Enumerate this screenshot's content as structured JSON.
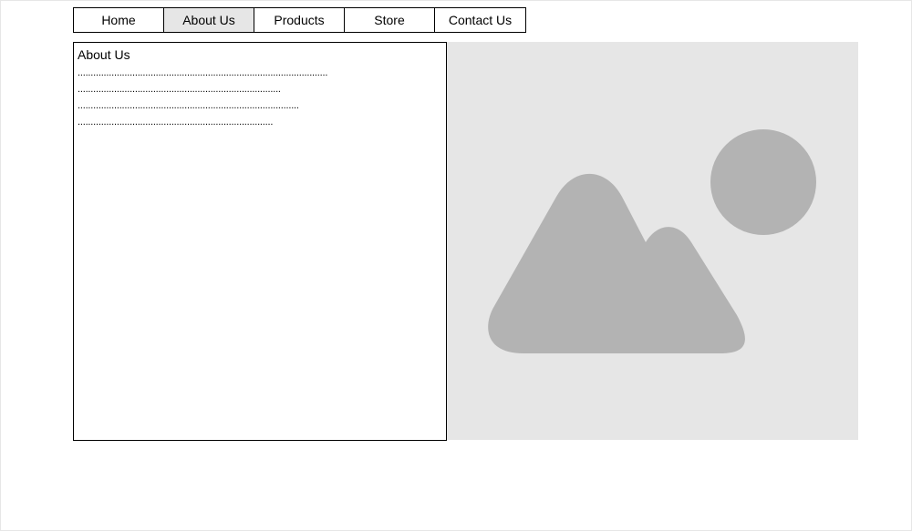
{
  "nav": {
    "items": [
      {
        "label": "Home",
        "active": false
      },
      {
        "label": "About Us",
        "active": true
      },
      {
        "label": "Products",
        "active": false
      },
      {
        "label": "Store",
        "active": false
      },
      {
        "label": "Contact Us",
        "active": false
      }
    ]
  },
  "about": {
    "title": "About Us",
    "lines": [
      "................................................................................................",
      "..............................................................................",
      ".....................................................................................",
      "..........................................................................."
    ]
  },
  "image": {
    "icon": "image-placeholder-icon",
    "background_color": "#e6e6e6",
    "shape_color": "#b3b3b3"
  }
}
